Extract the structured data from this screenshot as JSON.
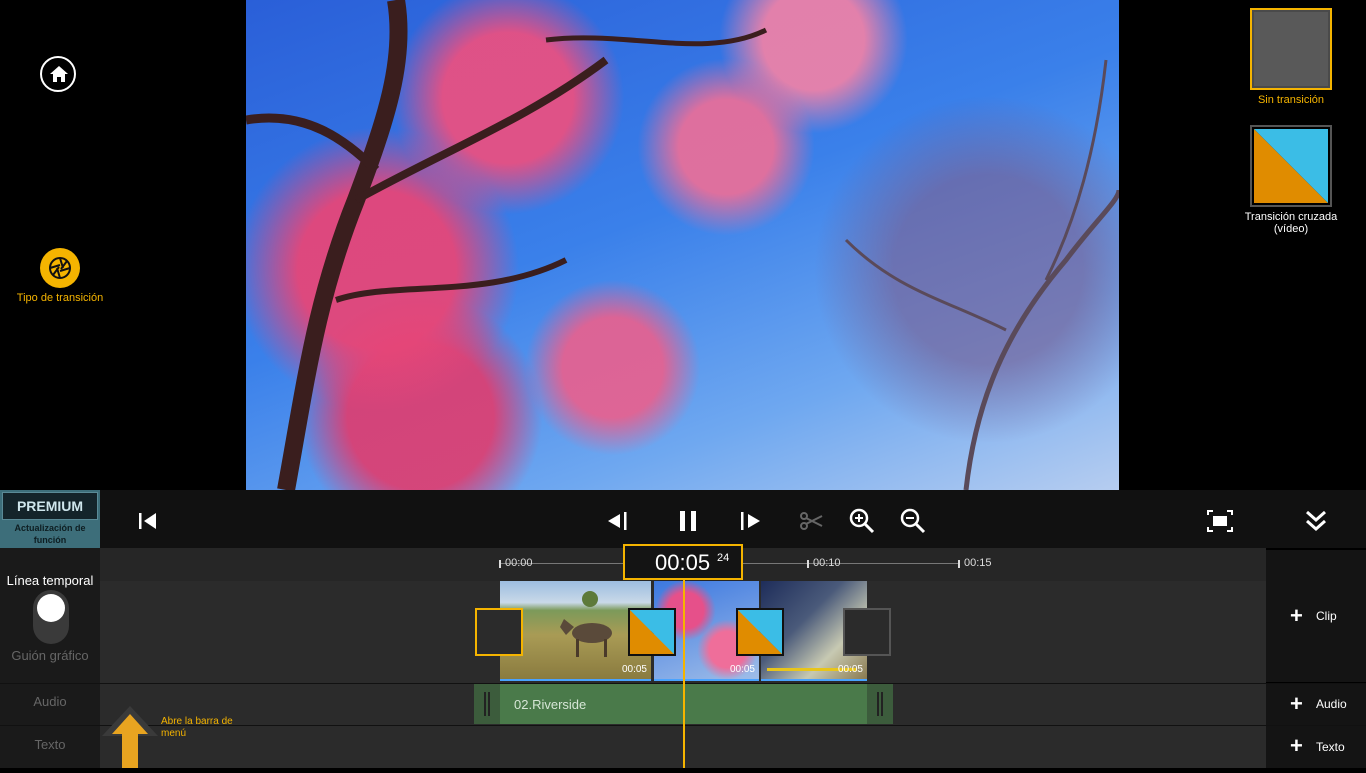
{
  "sidebar": {
    "transition_type_label": "Tipo de transición"
  },
  "transitions": {
    "none_label": "Sin transición",
    "cross_label": "Transición cruzada\n(vídeo)",
    "cross_colors": [
      "#e08c00",
      "#3bbde6"
    ]
  },
  "premium": {
    "title": "PREMIUM",
    "subtitle": "Actualización de función"
  },
  "ruler": {
    "ticks": [
      "00:00",
      "00:10",
      "00:15"
    ],
    "timecode": "00:05",
    "frame": "24"
  },
  "modes": {
    "timeline_label": "Línea temporal",
    "storyboard_label": "Guión gráfico"
  },
  "tracks": {
    "audio_label": "Audio",
    "text_label": "Texto"
  },
  "clips": [
    {
      "duration": "00:05"
    },
    {
      "duration": "00:05"
    },
    {
      "duration": "00:05"
    }
  ],
  "audio_clip": {
    "name": "02.Riverside"
  },
  "add_buttons": {
    "clip": "Clip",
    "audio": "Audio",
    "text": "Texto"
  },
  "hint": {
    "open_menu": "Abre la barra de menú"
  },
  "accent_color": "#f5b400"
}
